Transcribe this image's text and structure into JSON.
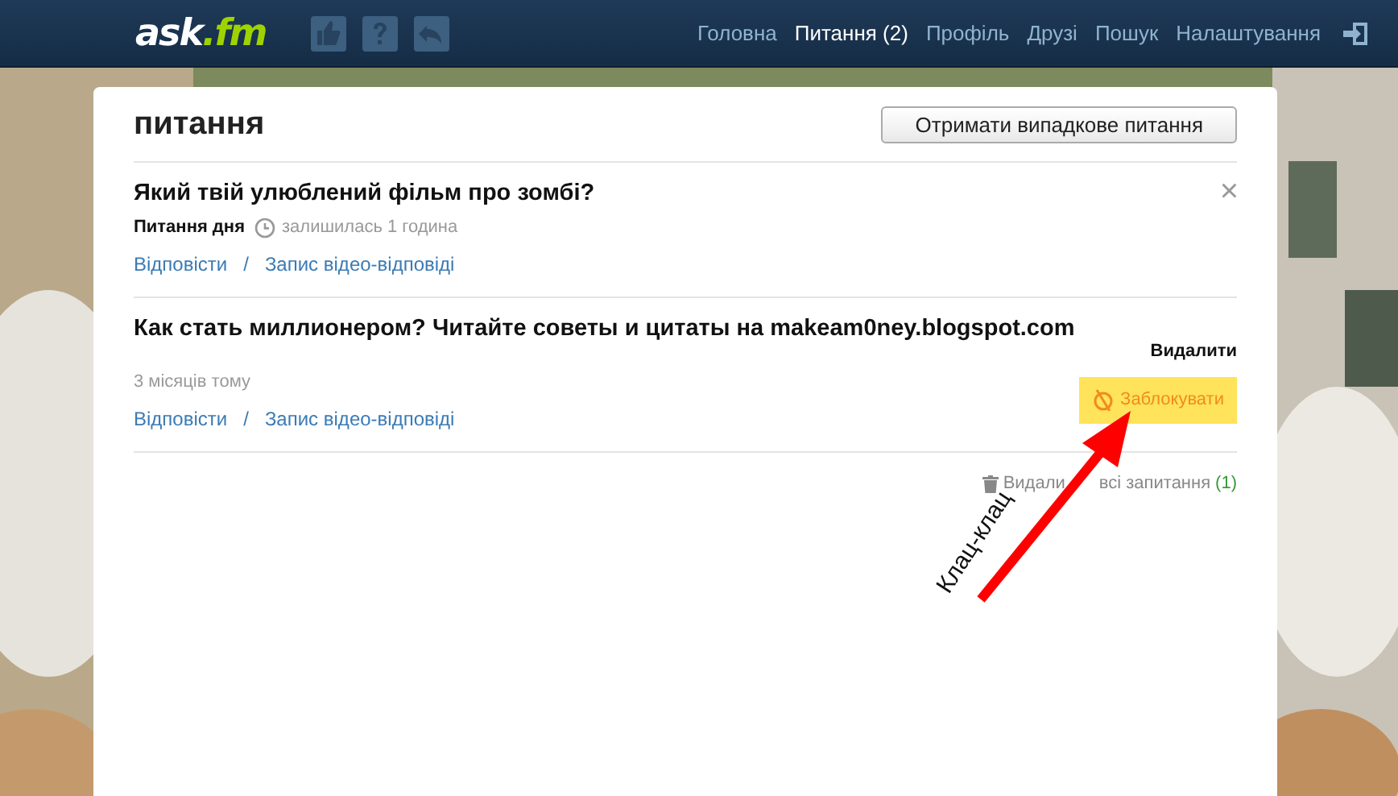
{
  "header": {
    "logo": "ask.fm",
    "nav": [
      {
        "label": "Головна",
        "selected": false
      },
      {
        "label": "Питання (2)",
        "selected": true
      },
      {
        "label": "Профіль",
        "selected": false
      },
      {
        "label": "Друзі",
        "selected": false
      },
      {
        "label": "Пошук",
        "selected": false
      },
      {
        "label": "Налаштування",
        "selected": false
      }
    ]
  },
  "page": {
    "title": "питання",
    "random_button": "Отримати випадкове питання",
    "questions": [
      {
        "text": "Який твій улюблений фільм про зомбі?",
        "featured_label": "Питання дня",
        "time": "залишилась 1 година",
        "actions": [
          "Відповісти",
          "Запис відео-відповіді"
        ],
        "separator": "/",
        "close": "×"
      },
      {
        "text": "Как стать миллионером? Читайте советы и цитаты на makeam0ney.blogspot.com",
        "time": "3 місяців тому",
        "actions": [
          "Відповісти",
          "Запис відео-відповіді"
        ],
        "separator": "/",
        "delete": "Видалити",
        "block": "Заблокувати"
      }
    ],
    "delete_all_start": "Видали",
    "delete_all_rest": "всі запитання",
    "delete_all_count": "(1)"
  },
  "annotation": {
    "text": "Клац-клац"
  }
}
